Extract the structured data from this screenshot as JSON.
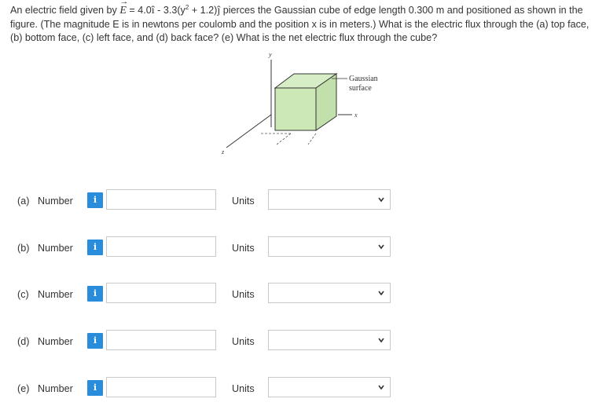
{
  "question": {
    "t1": "An electric field given by ",
    "E": "E",
    "t2": " = 4.0",
    "ihat": "î",
    "t3": " - 3.3(y",
    "exp": "2",
    "t4": " + 1.2)",
    "jhat": "ĵ",
    "t5": " pierces the Gaussian cube of edge length 0.300 m and positioned as shown in the figure. (The magnitude E is in newtons per coulomb and the position x is in meters.) What is the electric flux through the (a) top face, (b) bottom face, (c) left face, and (d) back face? (e) What is the net electric flux through the cube?"
  },
  "figure": {
    "label_gauss_1": "Gaussian",
    "label_gauss_2": "surface",
    "axis_y": "y",
    "axis_x": "x",
    "axis_z": "z"
  },
  "answers": [
    {
      "part": "(a)",
      "number_label": "Number",
      "info_glyph": "i",
      "value": "",
      "units_label": "Units",
      "units_value": ""
    },
    {
      "part": "(b)",
      "number_label": "Number",
      "info_glyph": "i",
      "value": "",
      "units_label": "Units",
      "units_value": ""
    },
    {
      "part": "(c)",
      "number_label": "Number",
      "info_glyph": "i",
      "value": "",
      "units_label": "Units",
      "units_value": ""
    },
    {
      "part": "(d)",
      "number_label": "Number",
      "info_glyph": "i",
      "value": "",
      "units_label": "Units",
      "units_value": ""
    },
    {
      "part": "(e)",
      "number_label": "Number",
      "info_glyph": "i",
      "value": "",
      "units_label": "Units",
      "units_value": ""
    }
  ],
  "icons": {
    "info": "info-icon",
    "dropdown": "chevron-down-icon"
  },
  "colors": {
    "info_button": "#2a8ddc",
    "cube_fill": "#c9e6b5",
    "input_border": "#c9c9c9"
  }
}
